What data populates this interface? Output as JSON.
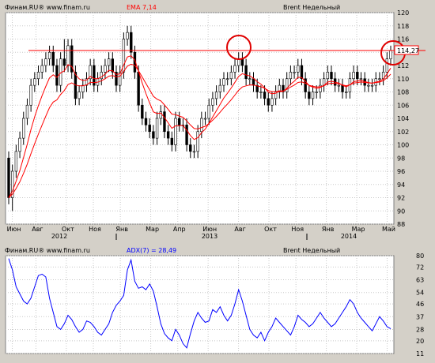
{
  "price_panel": {
    "header_left": "Финам.RU® www.finam.ru",
    "indicator_label": "EMA 7,14",
    "instrument": "Brent Недельный",
    "current_price_label": "114,27"
  },
  "adx_panel": {
    "header_left": "Финам.RU® www.finam.ru",
    "indicator_label": "ADX(7) = 28,49",
    "instrument": "Brent Недельный"
  },
  "colors": {
    "background": "#d4d0c8",
    "plot": "#ffffff",
    "bull": "#ffffff",
    "bear": "#000000",
    "ema": "#ff0000",
    "resistance": "#ff0000",
    "adx": "#0000ff",
    "annotation_circle": "#e00000"
  },
  "x_axis": {
    "month_labels": [
      "Июн",
      "Авг",
      "Окт",
      "Ноя",
      "Янв",
      "Мар",
      "Апр",
      "Июн",
      "Авг",
      "Окт",
      "Ноя",
      "Янв",
      "Мар",
      "Май"
    ],
    "year_labels": [
      "2012",
      "2013",
      "2014"
    ]
  },
  "chart_data": [
    {
      "type": "candlestick",
      "title": "Brent Недельный",
      "indicator": "EMA 7,14",
      "ylim": [
        88,
        120
      ],
      "yticks": [
        88,
        90,
        92,
        94,
        96,
        98,
        100,
        102,
        104,
        106,
        108,
        110,
        112,
        114,
        116,
        118,
        120
      ],
      "y_axis_side": "right",
      "horizontal_line": 114.27,
      "current_price": 114.27,
      "series": [
        {
          "name": "Brent",
          "open": [
            98,
            92,
            96,
            99,
            101,
            104,
            106,
            109,
            110,
            111,
            112,
            113,
            114,
            112,
            109,
            113,
            112,
            115,
            111,
            107,
            108,
            109,
            110,
            112,
            109,
            110,
            111,
            112,
            113,
            111,
            109,
            111,
            116,
            117,
            114,
            111,
            106,
            104,
            103,
            102,
            101,
            104,
            105,
            102,
            101,
            100,
            104,
            103,
            103,
            100,
            99,
            99,
            102,
            104,
            104,
            106,
            107,
            108,
            109,
            110,
            110,
            111,
            112,
            113,
            112,
            110,
            110,
            109,
            108,
            108,
            107,
            106,
            107,
            108,
            109,
            108,
            110,
            111,
            111,
            112,
            110,
            108,
            107,
            108,
            108,
            109,
            110,
            111,
            110,
            109,
            109,
            108,
            108,
            110,
            111,
            110,
            110,
            109,
            109,
            109,
            110,
            110,
            111,
            113
          ],
          "close": [
            92,
            96,
            99,
            101,
            104,
            106,
            109,
            110,
            111,
            112,
            113,
            114,
            112,
            109,
            113,
            112,
            115,
            111,
            107,
            108,
            109,
            110,
            112,
            109,
            110,
            111,
            112,
            113,
            111,
            109,
            111,
            116,
            117,
            114,
            111,
            106,
            104,
            103,
            102,
            101,
            104,
            105,
            102,
            101,
            100,
            104,
            103,
            103,
            100,
            99,
            99,
            102,
            104,
            104,
            106,
            107,
            108,
            109,
            110,
            110,
            111,
            112,
            113,
            112,
            110,
            110,
            109,
            108,
            108,
            107,
            106,
            107,
            108,
            109,
            108,
            110,
            111,
            111,
            112,
            110,
            108,
            107,
            108,
            108,
            109,
            110,
            111,
            110,
            109,
            109,
            108,
            108,
            110,
            111,
            110,
            110,
            109,
            109,
            109,
            110,
            110,
            111,
            113,
            114.27
          ],
          "high": [
            99,
            97,
            100,
            102,
            105,
            107,
            110,
            111,
            112,
            113,
            114,
            115,
            115,
            113,
            114,
            116,
            116,
            116,
            112,
            109,
            110,
            111,
            113,
            113,
            111,
            112,
            113,
            114,
            114,
            112,
            112,
            117,
            118,
            118,
            115,
            112,
            107,
            105,
            104,
            103,
            105,
            106,
            106,
            103,
            102,
            105,
            105,
            104,
            104,
            101,
            100,
            103,
            105,
            105,
            107,
            108,
            109,
            110,
            111,
            111,
            112,
            113,
            114,
            114,
            113,
            111,
            111,
            110,
            109,
            109,
            108,
            108,
            109,
            110,
            110,
            111,
            112,
            112,
            113,
            113,
            111,
            109,
            109,
            109,
            110,
            111,
            112,
            112,
            111,
            110,
            110,
            109,
            111,
            112,
            112,
            111,
            111,
            110,
            110,
            111,
            111,
            112,
            114,
            115
          ],
          "low": [
            91,
            90,
            95,
            98,
            100,
            103,
            105,
            108,
            109,
            110,
            111,
            112,
            111,
            108,
            108,
            111,
            111,
            110,
            106,
            106,
            107,
            108,
            109,
            108,
            108,
            109,
            110,
            111,
            110,
            108,
            108,
            110,
            115,
            113,
            110,
            105,
            103,
            102,
            101,
            100,
            100,
            103,
            101,
            100,
            99,
            99,
            102,
            102,
            99,
            98,
            98,
            98,
            101,
            103,
            103,
            105,
            106,
            107,
            108,
            109,
            109,
            110,
            111,
            111,
            109,
            109,
            108,
            107,
            107,
            106,
            105,
            105,
            106,
            107,
            107,
            107,
            109,
            110,
            110,
            109,
            107,
            106,
            106,
            107,
            107,
            108,
            109,
            109,
            108,
            108,
            107,
            107,
            107,
            109,
            109,
            109,
            108,
            108,
            108,
            108,
            109,
            109,
            110,
            112
          ]
        }
      ]
    },
    {
      "type": "line",
      "title": "ADX(7) = 28,49",
      "ylim": [
        11,
        80
      ],
      "yticks": [
        11,
        20,
        28,
        37,
        46,
        54,
        63,
        72,
        80
      ],
      "y_axis_side": "right",
      "series": [
        {
          "name": "ADX(7)",
          "values": [
            78,
            70,
            58,
            53,
            48,
            46,
            50,
            58,
            66,
            67,
            65,
            50,
            40,
            30,
            28,
            32,
            38,
            35,
            30,
            26,
            28,
            34,
            33,
            30,
            26,
            24,
            28,
            32,
            40,
            45,
            48,
            52,
            70,
            77,
            62,
            57,
            58,
            56,
            60,
            55,
            44,
            32,
            25,
            22,
            20,
            28,
            24,
            18,
            15,
            25,
            34,
            40,
            36,
            33,
            34,
            42,
            40,
            44,
            38,
            34,
            38,
            46,
            56,
            48,
            38,
            28,
            24,
            22,
            26,
            20,
            26,
            30,
            36,
            33,
            30,
            27,
            24,
            30,
            38,
            35,
            33,
            30,
            32,
            36,
            40,
            36,
            33,
            30,
            32,
            36,
            40,
            44,
            49,
            46,
            40,
            36,
            33,
            30,
            27,
            32,
            37,
            34,
            30,
            28.49
          ]
        }
      ]
    }
  ]
}
